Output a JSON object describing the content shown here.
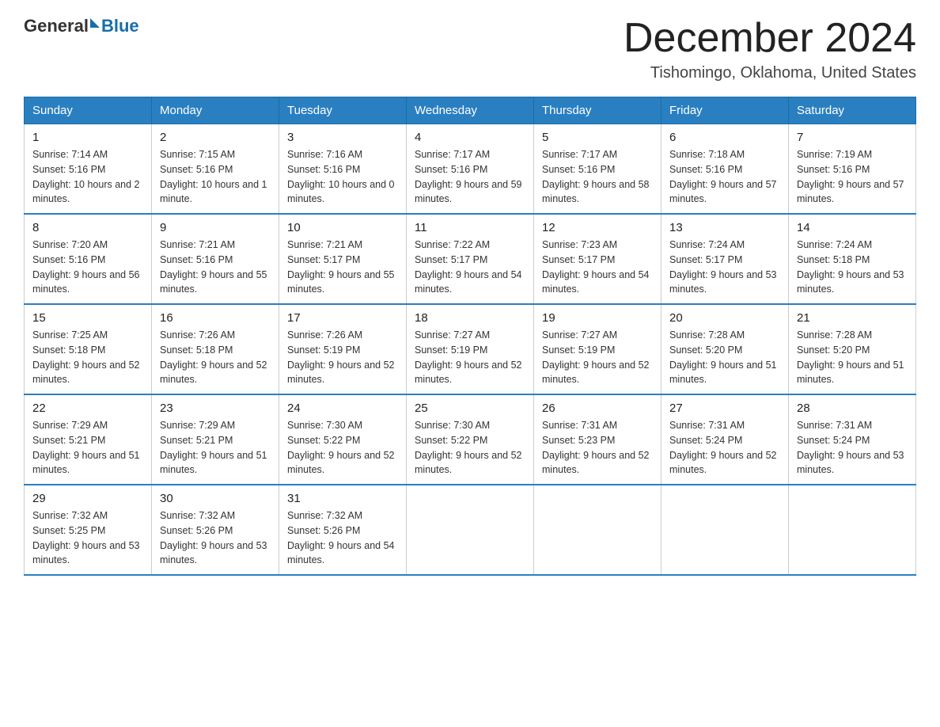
{
  "header": {
    "logo_general": "General",
    "logo_blue": "Blue",
    "month": "December 2024",
    "location": "Tishomingo, Oklahoma, United States"
  },
  "columns": [
    "Sunday",
    "Monday",
    "Tuesday",
    "Wednesday",
    "Thursday",
    "Friday",
    "Saturday"
  ],
  "weeks": [
    [
      {
        "day": "1",
        "sunrise": "7:14 AM",
        "sunset": "5:16 PM",
        "daylight": "10 hours and 2 minutes."
      },
      {
        "day": "2",
        "sunrise": "7:15 AM",
        "sunset": "5:16 PM",
        "daylight": "10 hours and 1 minute."
      },
      {
        "day": "3",
        "sunrise": "7:16 AM",
        "sunset": "5:16 PM",
        "daylight": "10 hours and 0 minutes."
      },
      {
        "day": "4",
        "sunrise": "7:17 AM",
        "sunset": "5:16 PM",
        "daylight": "9 hours and 59 minutes."
      },
      {
        "day": "5",
        "sunrise": "7:17 AM",
        "sunset": "5:16 PM",
        "daylight": "9 hours and 58 minutes."
      },
      {
        "day": "6",
        "sunrise": "7:18 AM",
        "sunset": "5:16 PM",
        "daylight": "9 hours and 57 minutes."
      },
      {
        "day": "7",
        "sunrise": "7:19 AM",
        "sunset": "5:16 PM",
        "daylight": "9 hours and 57 minutes."
      }
    ],
    [
      {
        "day": "8",
        "sunrise": "7:20 AM",
        "sunset": "5:16 PM",
        "daylight": "9 hours and 56 minutes."
      },
      {
        "day": "9",
        "sunrise": "7:21 AM",
        "sunset": "5:16 PM",
        "daylight": "9 hours and 55 minutes."
      },
      {
        "day": "10",
        "sunrise": "7:21 AM",
        "sunset": "5:17 PM",
        "daylight": "9 hours and 55 minutes."
      },
      {
        "day": "11",
        "sunrise": "7:22 AM",
        "sunset": "5:17 PM",
        "daylight": "9 hours and 54 minutes."
      },
      {
        "day": "12",
        "sunrise": "7:23 AM",
        "sunset": "5:17 PM",
        "daylight": "9 hours and 54 minutes."
      },
      {
        "day": "13",
        "sunrise": "7:24 AM",
        "sunset": "5:17 PM",
        "daylight": "9 hours and 53 minutes."
      },
      {
        "day": "14",
        "sunrise": "7:24 AM",
        "sunset": "5:18 PM",
        "daylight": "9 hours and 53 minutes."
      }
    ],
    [
      {
        "day": "15",
        "sunrise": "7:25 AM",
        "sunset": "5:18 PM",
        "daylight": "9 hours and 52 minutes."
      },
      {
        "day": "16",
        "sunrise": "7:26 AM",
        "sunset": "5:18 PM",
        "daylight": "9 hours and 52 minutes."
      },
      {
        "day": "17",
        "sunrise": "7:26 AM",
        "sunset": "5:19 PM",
        "daylight": "9 hours and 52 minutes."
      },
      {
        "day": "18",
        "sunrise": "7:27 AM",
        "sunset": "5:19 PM",
        "daylight": "9 hours and 52 minutes."
      },
      {
        "day": "19",
        "sunrise": "7:27 AM",
        "sunset": "5:19 PM",
        "daylight": "9 hours and 52 minutes."
      },
      {
        "day": "20",
        "sunrise": "7:28 AM",
        "sunset": "5:20 PM",
        "daylight": "9 hours and 51 minutes."
      },
      {
        "day": "21",
        "sunrise": "7:28 AM",
        "sunset": "5:20 PM",
        "daylight": "9 hours and 51 minutes."
      }
    ],
    [
      {
        "day": "22",
        "sunrise": "7:29 AM",
        "sunset": "5:21 PM",
        "daylight": "9 hours and 51 minutes."
      },
      {
        "day": "23",
        "sunrise": "7:29 AM",
        "sunset": "5:21 PM",
        "daylight": "9 hours and 51 minutes."
      },
      {
        "day": "24",
        "sunrise": "7:30 AM",
        "sunset": "5:22 PM",
        "daylight": "9 hours and 52 minutes."
      },
      {
        "day": "25",
        "sunrise": "7:30 AM",
        "sunset": "5:22 PM",
        "daylight": "9 hours and 52 minutes."
      },
      {
        "day": "26",
        "sunrise": "7:31 AM",
        "sunset": "5:23 PM",
        "daylight": "9 hours and 52 minutes."
      },
      {
        "day": "27",
        "sunrise": "7:31 AM",
        "sunset": "5:24 PM",
        "daylight": "9 hours and 52 minutes."
      },
      {
        "day": "28",
        "sunrise": "7:31 AM",
        "sunset": "5:24 PM",
        "daylight": "9 hours and 53 minutes."
      }
    ],
    [
      {
        "day": "29",
        "sunrise": "7:32 AM",
        "sunset": "5:25 PM",
        "daylight": "9 hours and 53 minutes."
      },
      {
        "day": "30",
        "sunrise": "7:32 AM",
        "sunset": "5:26 PM",
        "daylight": "9 hours and 53 minutes."
      },
      {
        "day": "31",
        "sunrise": "7:32 AM",
        "sunset": "5:26 PM",
        "daylight": "9 hours and 54 minutes."
      },
      null,
      null,
      null,
      null
    ]
  ]
}
